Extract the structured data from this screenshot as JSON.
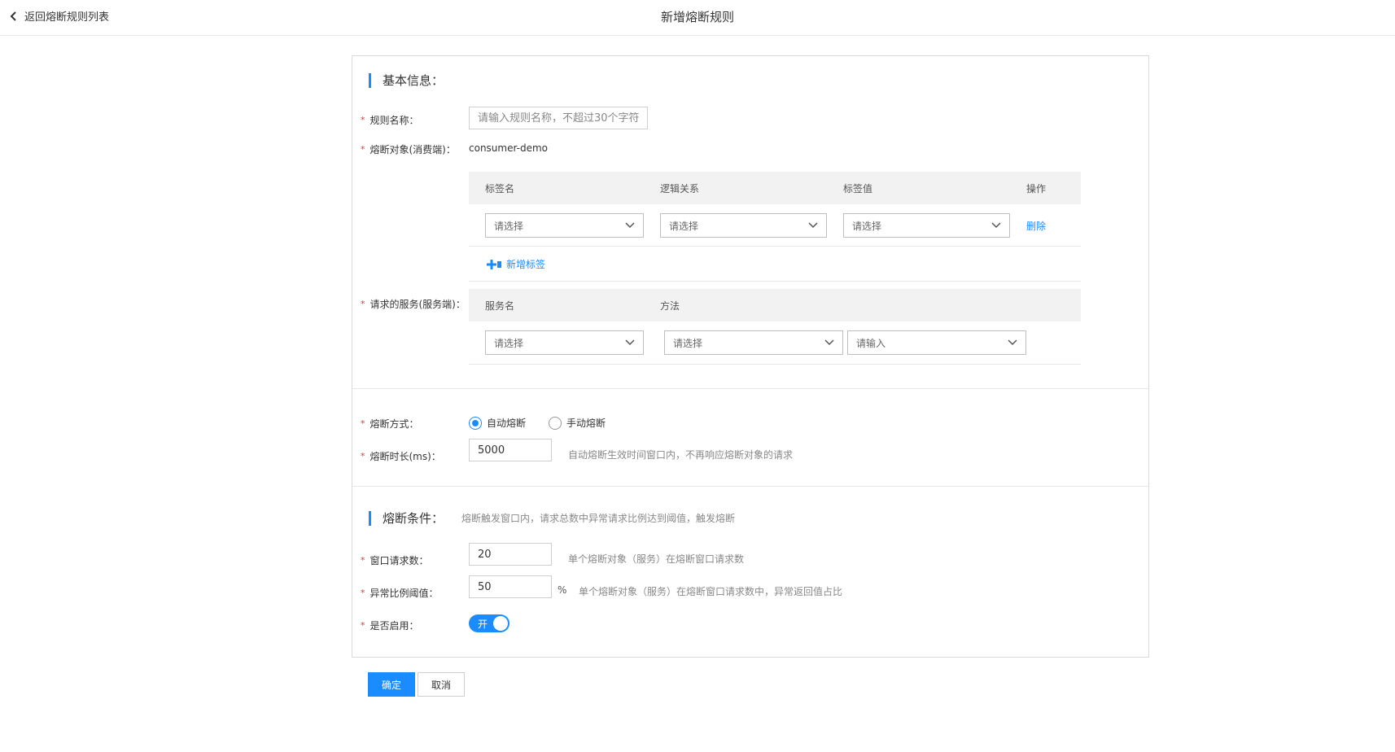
{
  "header": {
    "back_label": "返回熔断规则列表",
    "title": "新增熔断规则"
  },
  "basic": {
    "section_title": "基本信息：",
    "rule_name": {
      "label": "规则名称：",
      "placeholder": "请输入规则名称，不超过30个字符",
      "value": ""
    },
    "target": {
      "label": "熔断对象(消费端)：",
      "value": "consumer-demo",
      "columns": [
        "标签名",
        "逻辑关系",
        "标签值",
        "操作"
      ],
      "row": {
        "tag_name": "请选择",
        "logic": "请选择",
        "tag_value": "请选择",
        "action": "删除"
      },
      "add_tag_label": "新增标签"
    },
    "service": {
      "label": "请求的服务(服务端)：",
      "columns": [
        "服务名",
        "方法"
      ],
      "service_name": "请选择",
      "method": "请选择",
      "method_input_placeholder": "请输入"
    }
  },
  "mode": {
    "label": "熔断方式：",
    "options": [
      "自动熔断",
      "手动熔断"
    ],
    "selected": "自动熔断"
  },
  "duration": {
    "label": "熔断时长(ms)：",
    "value": "5000",
    "help": "自动熔断生效时间窗口内，不再响应熔断对象的请求"
  },
  "conditions": {
    "section_title": "熔断条件：",
    "hint": "熔断触发窗口内，请求总数中异常请求比例达到阈值，触发熔断",
    "window_requests": {
      "label": "窗口请求数：",
      "value": "20",
      "help": "单个熔断对象（服务）在熔断窗口请求数"
    },
    "error_ratio": {
      "label": "异常比例阈值：",
      "value": "50",
      "unit": "%",
      "help": "单个熔断对象（服务）在熔断窗口请求数中，异常返回值占比"
    },
    "enabled": {
      "label": "是否启用：",
      "toggle_label": "开",
      "on": true
    }
  },
  "footer": {
    "confirm_label": "确定",
    "cancel_label": "取消"
  },
  "colors": {
    "accent": "#1a8cff",
    "required": "#e53935"
  }
}
